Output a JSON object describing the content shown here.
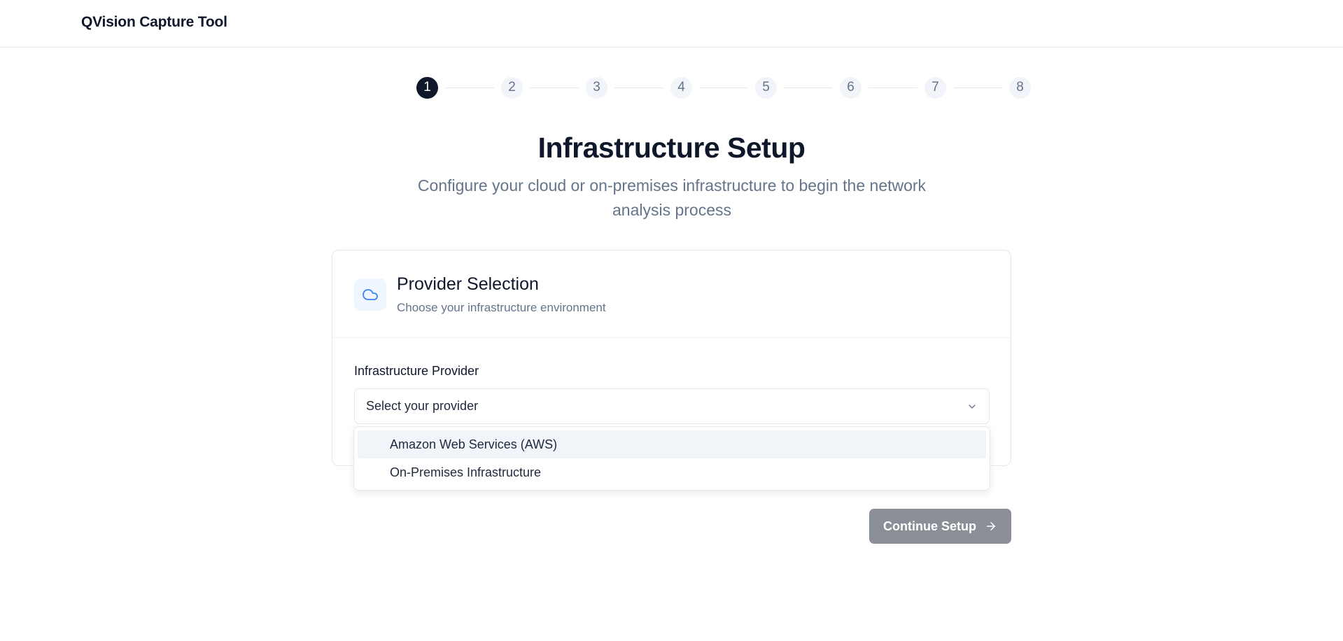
{
  "header": {
    "app_title": "QVision Capture Tool"
  },
  "stepper": {
    "steps": [
      "1",
      "2",
      "3",
      "4",
      "5",
      "6",
      "7",
      "8"
    ],
    "active_index": 0
  },
  "page": {
    "title": "Infrastructure Setup",
    "subtitle": "Configure your cloud or on-premises infrastructure to begin the network analysis process"
  },
  "card": {
    "icon": "cloud-icon",
    "title": "Provider Selection",
    "subtitle": "Choose your infrastructure environment",
    "field_label": "Infrastructure Provider",
    "select_placeholder": "Select your provider"
  },
  "dropdown": {
    "options": [
      "Amazon Web Services (AWS)",
      "On-Premises Infrastructure"
    ],
    "highlighted_index": 0
  },
  "actions": {
    "continue_label": "Continue Setup"
  },
  "colors": {
    "accent": "#3b82f6",
    "active_step": "#0f172a",
    "disabled_button": "#8a8f97"
  }
}
